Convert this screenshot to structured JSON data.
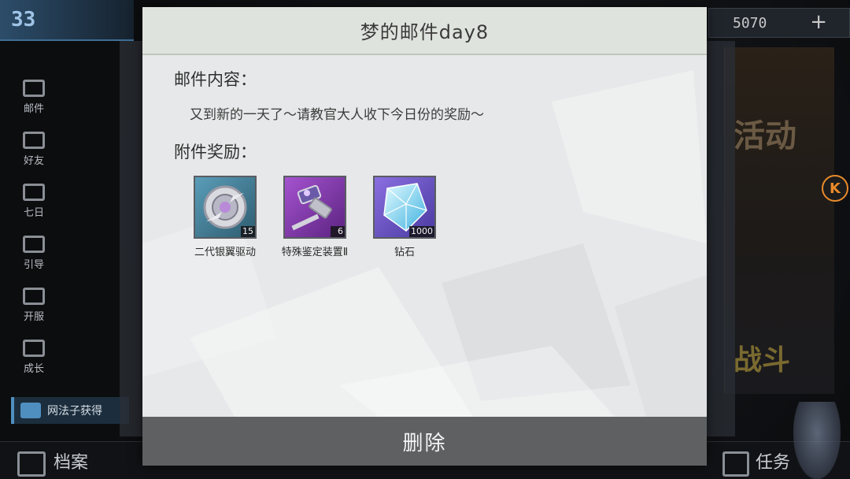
{
  "background": {
    "level_text": "33",
    "resource_value": "5070",
    "resource_plus": "+",
    "side_menu": [
      "邮件",
      "好友",
      "七日",
      "引导",
      "开服",
      "成长"
    ],
    "get_banner": "网法子获得",
    "bottom_left": "档案",
    "bottom_right": "任务",
    "event_text": "活动",
    "battle_text": "战斗",
    "k_button": "K"
  },
  "dialog": {
    "title": "梦的邮件day8",
    "content_label": "邮件内容：",
    "content_text": "又到新的一天了～请教官大人收下今日份的奖励～",
    "attachments_label": "附件奖励：",
    "rewards": [
      {
        "name": "二代银翼驱动",
        "count": "15",
        "icon": "silver-wing-drive-icon",
        "tile_color": "#4a7f95"
      },
      {
        "name": "特殊鉴定装置Ⅱ",
        "count": "6",
        "icon": "special-appraisal-device-icon",
        "tile_color": "#8a3fb0"
      },
      {
        "name": "钻石",
        "count": "1000",
        "icon": "diamond-icon",
        "tile_color": "#6a5bc4"
      }
    ],
    "delete_label": "删除"
  },
  "colors": {
    "dialog_bg": "#e7e8e9",
    "header_bg": "#dfe3dd",
    "delete_bg": "#5e6062",
    "accent_orange": "#e98a2a"
  }
}
